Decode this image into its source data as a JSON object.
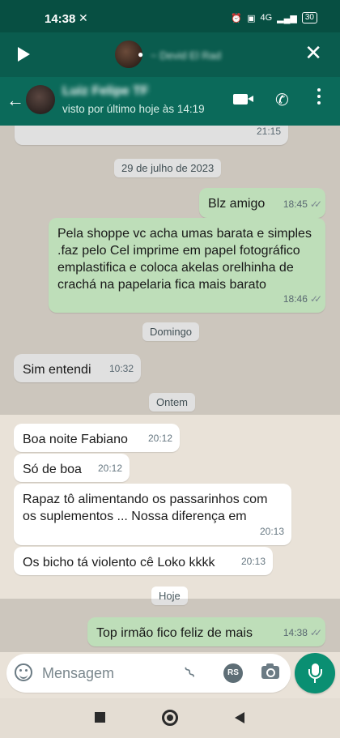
{
  "status_bar": {
    "time": "14:38",
    "network": "4G",
    "battery": "30"
  },
  "audio_bar": {
    "contact_name": "~ Devid El Rad"
  },
  "chat_header": {
    "contact_name": "Luiz Felipe TF",
    "status": "visto por último hoje às 14:19"
  },
  "messages": [
    {
      "type": "in",
      "text": "",
      "time": "21:15"
    },
    {
      "type": "date",
      "text": "29 de julho de 2023"
    },
    {
      "type": "out",
      "text": "Blz amigo",
      "time": "18:45"
    },
    {
      "type": "out",
      "text": "Pela shoppe vc acha umas barata e simples .faz pelo Cel imprime em papel fotográfico emplastifica e coloca akelas orelhinha de  crachá na papelaria fica mais barato",
      "time": "18:46"
    },
    {
      "type": "date",
      "text": "Domingo"
    },
    {
      "type": "in",
      "text": "Sim entendi",
      "time": "10:32"
    },
    {
      "type": "date",
      "text": "Ontem"
    },
    {
      "type": "in",
      "text": "Boa noite Fabiano",
      "time": "20:12"
    },
    {
      "type": "in",
      "text": "Só de boa",
      "time": "20:12"
    },
    {
      "type": "in",
      "text": "Rapaz tô alimentando os passarinhos com os suplementos ... Nossa diferença em",
      "time": "20:13"
    },
    {
      "type": "in",
      "text": "Os bicho tá violento cê Loko kkkk",
      "time": "20:13"
    },
    {
      "type": "date",
      "text": "Hoje"
    },
    {
      "type": "out",
      "text": "Top irmão fico feliz de mais",
      "time": "14:38"
    }
  ],
  "composer": {
    "placeholder": "Mensagem",
    "rs_badge": "RS"
  },
  "colors": {
    "header": "#0b6a5a",
    "outgoing": "#d9fdd3",
    "incoming": "#ffffff",
    "mic_button": "#0a8f72"
  }
}
